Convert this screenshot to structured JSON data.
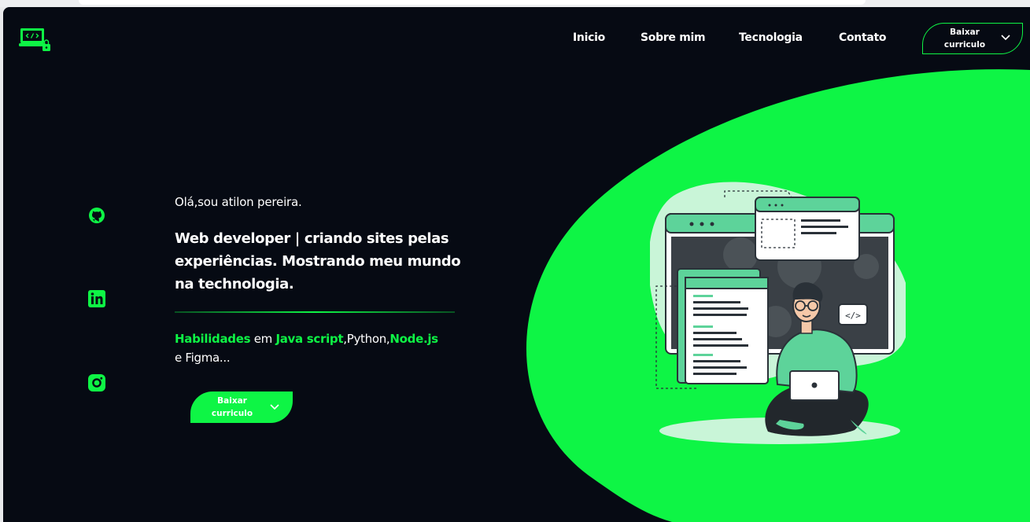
{
  "colors": {
    "background": "#060a13",
    "accent": "#0ef545",
    "text": "#ffffff"
  },
  "header": {
    "logo": "code-laptop-logo",
    "nav": [
      {
        "label": "Inicio"
      },
      {
        "label": "Sobre mim"
      },
      {
        "label": "Tecnologia"
      },
      {
        "label": "Contato"
      }
    ],
    "download_btn": {
      "line1": "Baixar",
      "line2": "curriculo",
      "icon": "chevron-down-icon"
    }
  },
  "social": [
    {
      "icon": "github-icon"
    },
    {
      "icon": "linkedin-icon"
    },
    {
      "icon": "instagram-icon"
    }
  ],
  "hero": {
    "greeting": "Olá,sou atilon pereira.",
    "headline_line1": "Web developer | criando sites pelas",
    "headline_line2": "experiências. Mostrando meu mundo",
    "headline_line3": "na technologia.",
    "skills": {
      "w1": "Habilidades",
      "w2": " em ",
      "w3": "Java script",
      "w4": ",Python,",
      "w5": "Node.js",
      "w6": "e Figma..."
    },
    "cta": {
      "line1": "Baixar",
      "line2": "curriculo",
      "icon": "chevron-down-icon"
    }
  },
  "illustration": "developer-with-laptop-illustration"
}
